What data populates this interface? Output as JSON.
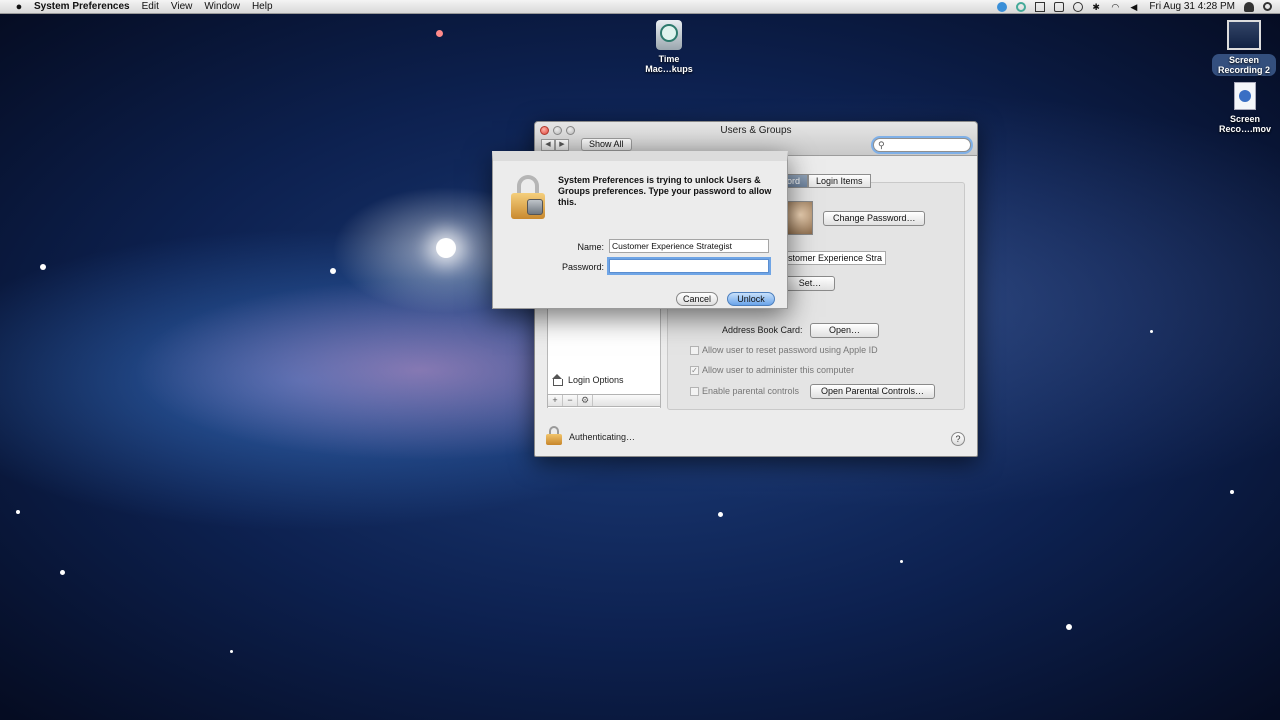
{
  "menubar": {
    "app_name": "System Preferences",
    "menus": [
      "Edit",
      "View",
      "Window",
      "Help"
    ],
    "clock": "Fri Aug 31  4:28 PM"
  },
  "desktop": {
    "time_machine": {
      "line1": "Time",
      "line2": "Mac…kups"
    },
    "recording_img": {
      "line1": "Screen",
      "line2": "Recording 2"
    },
    "recording_mov": {
      "line1": "Screen",
      "line2": "Reco….mov"
    }
  },
  "window": {
    "title": "Users & Groups",
    "nav_back": "◀",
    "nav_forward": "▶",
    "show_all": "Show All",
    "search_placeholder": "",
    "tabs": {
      "password_partial": "ord",
      "login_items": "Login Items"
    },
    "change_password": "Change Password…",
    "full_name_partial": "stomer Experience Stra",
    "set_button": "Set…",
    "address_book_label": "Address Book Card:",
    "open_button": "Open…",
    "checkboxes": {
      "reset_apple_id": "Allow user to reset password using Apple ID",
      "administer": "Allow user to administer this computer",
      "parental": "Enable parental controls"
    },
    "open_parental": "Open Parental Controls…",
    "login_options": "Login Options",
    "list_add": "+",
    "list_remove": "−",
    "list_gear": "⚙",
    "auth_status": "Authenticating…",
    "help": "?"
  },
  "dialog": {
    "message": "System Preferences is trying to unlock Users & Groups preferences. Type your password to allow this.",
    "name_label": "Name:",
    "name_value": "Customer Experience Strategist",
    "password_label": "Password:",
    "password_value": "",
    "cancel": "Cancel",
    "unlock": "Unlock"
  }
}
